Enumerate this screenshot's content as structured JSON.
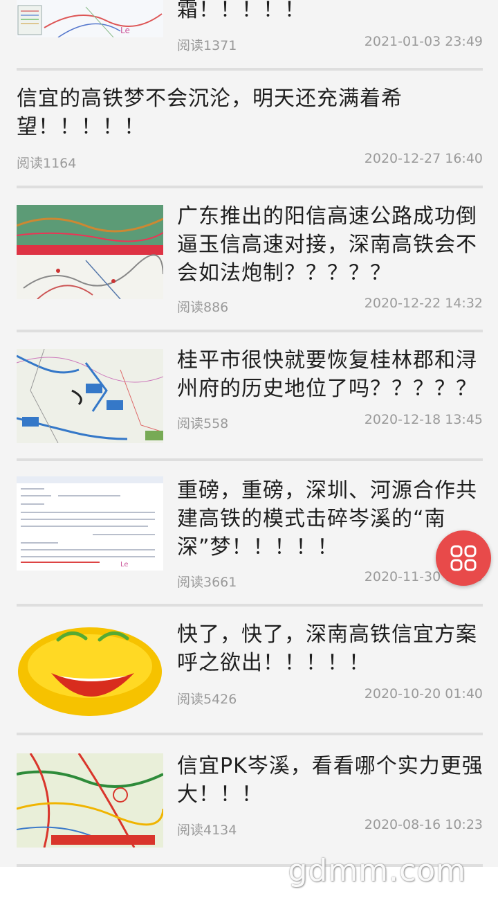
{
  "articles": [
    {
      "title": "霜！！！！！",
      "reads": "阅读1371",
      "date": "2021-01-03 23:49",
      "thumb": "map-icon"
    },
    {
      "title": "信宜的高铁梦不会沉沦，明天还充满着希望！！！！！",
      "reads": "阅读1164",
      "date": "2020-12-27 16:40"
    },
    {
      "title": "广东推出的阳信高速公路成功倒逼玉信高速对接，深南高铁会不会如法炮制？？？？？",
      "reads": "阅读886",
      "date": "2020-12-22 14:32",
      "thumb": "highway-map-icon"
    },
    {
      "title": "桂平市很快就要恢复桂林郡和浔州府的历史地位了吗？？？？？",
      "reads": "阅读558",
      "date": "2020-12-18 13:45",
      "thumb": "region-map-icon"
    },
    {
      "title": "重磅，重磅，深圳、河源合作共建高铁的模式击碎岑溪的“南深”梦！！！！！",
      "reads": "阅读3661",
      "date": "2020-11-30 14:16",
      "thumb": "document-icon"
    },
    {
      "title": "快了，快了，深南高铁信宜方案呼之欲出！！！！！",
      "reads": "阅读5426",
      "date": "2020-10-20 01:40",
      "thumb": "laughing-face-icon"
    },
    {
      "title": "信宜PK岑溪，看看哪个实力更强大！！！",
      "reads": "阅读4134",
      "date": "2020-08-16 10:23",
      "thumb": "road-map-icon"
    }
  ],
  "fab": {
    "icon": "grid-menu-icon",
    "color": "#e84a4a"
  },
  "watermark": "gdmm.com"
}
